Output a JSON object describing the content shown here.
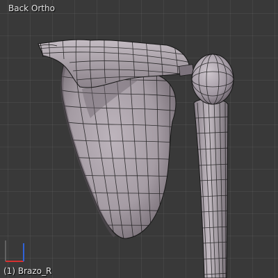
{
  "viewport": {
    "view_name": "Back Ortho",
    "object_label": "(1) Brazo_R",
    "mesh_name": "Brazo_R",
    "shading": "solid-wireframe",
    "colors": {
      "background": "#393939",
      "mesh_surface": "#a39aa2",
      "mesh_wire": "#161616",
      "text": "#e6e6e6",
      "axis_x": "#d9302f",
      "axis_z": "#2f62d9"
    },
    "axes_gizmo_icon": "axes-gizmo-icon"
  }
}
